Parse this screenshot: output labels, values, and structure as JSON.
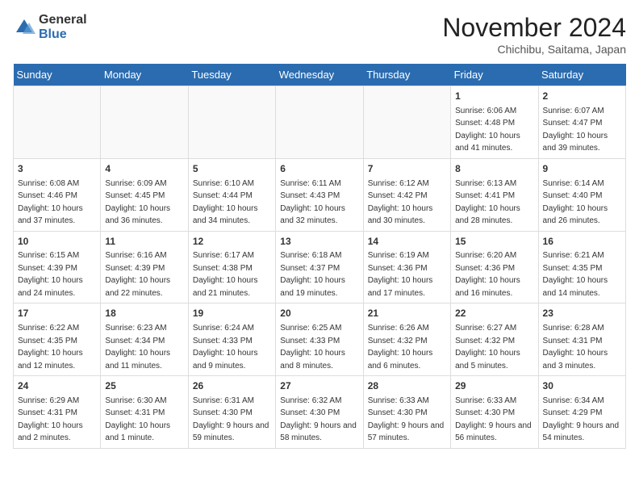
{
  "header": {
    "logo_general": "General",
    "logo_blue": "Blue",
    "month_year": "November 2024",
    "location": "Chichibu, Saitama, Japan"
  },
  "days_of_week": [
    "Sunday",
    "Monday",
    "Tuesday",
    "Wednesday",
    "Thursday",
    "Friday",
    "Saturday"
  ],
  "weeks": [
    [
      {
        "day": "",
        "info": ""
      },
      {
        "day": "",
        "info": ""
      },
      {
        "day": "",
        "info": ""
      },
      {
        "day": "",
        "info": ""
      },
      {
        "day": "",
        "info": ""
      },
      {
        "day": "1",
        "info": "Sunrise: 6:06 AM\nSunset: 4:48 PM\nDaylight: 10 hours and 41 minutes."
      },
      {
        "day": "2",
        "info": "Sunrise: 6:07 AM\nSunset: 4:47 PM\nDaylight: 10 hours and 39 minutes."
      }
    ],
    [
      {
        "day": "3",
        "info": "Sunrise: 6:08 AM\nSunset: 4:46 PM\nDaylight: 10 hours and 37 minutes."
      },
      {
        "day": "4",
        "info": "Sunrise: 6:09 AM\nSunset: 4:45 PM\nDaylight: 10 hours and 36 minutes."
      },
      {
        "day": "5",
        "info": "Sunrise: 6:10 AM\nSunset: 4:44 PM\nDaylight: 10 hours and 34 minutes."
      },
      {
        "day": "6",
        "info": "Sunrise: 6:11 AM\nSunset: 4:43 PM\nDaylight: 10 hours and 32 minutes."
      },
      {
        "day": "7",
        "info": "Sunrise: 6:12 AM\nSunset: 4:42 PM\nDaylight: 10 hours and 30 minutes."
      },
      {
        "day": "8",
        "info": "Sunrise: 6:13 AM\nSunset: 4:41 PM\nDaylight: 10 hours and 28 minutes."
      },
      {
        "day": "9",
        "info": "Sunrise: 6:14 AM\nSunset: 4:40 PM\nDaylight: 10 hours and 26 minutes."
      }
    ],
    [
      {
        "day": "10",
        "info": "Sunrise: 6:15 AM\nSunset: 4:39 PM\nDaylight: 10 hours and 24 minutes."
      },
      {
        "day": "11",
        "info": "Sunrise: 6:16 AM\nSunset: 4:39 PM\nDaylight: 10 hours and 22 minutes."
      },
      {
        "day": "12",
        "info": "Sunrise: 6:17 AM\nSunset: 4:38 PM\nDaylight: 10 hours and 21 minutes."
      },
      {
        "day": "13",
        "info": "Sunrise: 6:18 AM\nSunset: 4:37 PM\nDaylight: 10 hours and 19 minutes."
      },
      {
        "day": "14",
        "info": "Sunrise: 6:19 AM\nSunset: 4:36 PM\nDaylight: 10 hours and 17 minutes."
      },
      {
        "day": "15",
        "info": "Sunrise: 6:20 AM\nSunset: 4:36 PM\nDaylight: 10 hours and 16 minutes."
      },
      {
        "day": "16",
        "info": "Sunrise: 6:21 AM\nSunset: 4:35 PM\nDaylight: 10 hours and 14 minutes."
      }
    ],
    [
      {
        "day": "17",
        "info": "Sunrise: 6:22 AM\nSunset: 4:35 PM\nDaylight: 10 hours and 12 minutes."
      },
      {
        "day": "18",
        "info": "Sunrise: 6:23 AM\nSunset: 4:34 PM\nDaylight: 10 hours and 11 minutes."
      },
      {
        "day": "19",
        "info": "Sunrise: 6:24 AM\nSunset: 4:33 PM\nDaylight: 10 hours and 9 minutes."
      },
      {
        "day": "20",
        "info": "Sunrise: 6:25 AM\nSunset: 4:33 PM\nDaylight: 10 hours and 8 minutes."
      },
      {
        "day": "21",
        "info": "Sunrise: 6:26 AM\nSunset: 4:32 PM\nDaylight: 10 hours and 6 minutes."
      },
      {
        "day": "22",
        "info": "Sunrise: 6:27 AM\nSunset: 4:32 PM\nDaylight: 10 hours and 5 minutes."
      },
      {
        "day": "23",
        "info": "Sunrise: 6:28 AM\nSunset: 4:31 PM\nDaylight: 10 hours and 3 minutes."
      }
    ],
    [
      {
        "day": "24",
        "info": "Sunrise: 6:29 AM\nSunset: 4:31 PM\nDaylight: 10 hours and 2 minutes."
      },
      {
        "day": "25",
        "info": "Sunrise: 6:30 AM\nSunset: 4:31 PM\nDaylight: 10 hours and 1 minute."
      },
      {
        "day": "26",
        "info": "Sunrise: 6:31 AM\nSunset: 4:30 PM\nDaylight: 9 hours and 59 minutes."
      },
      {
        "day": "27",
        "info": "Sunrise: 6:32 AM\nSunset: 4:30 PM\nDaylight: 9 hours and 58 minutes."
      },
      {
        "day": "28",
        "info": "Sunrise: 6:33 AM\nSunset: 4:30 PM\nDaylight: 9 hours and 57 minutes."
      },
      {
        "day": "29",
        "info": "Sunrise: 6:33 AM\nSunset: 4:30 PM\nDaylight: 9 hours and 56 minutes."
      },
      {
        "day": "30",
        "info": "Sunrise: 6:34 AM\nSunset: 4:29 PM\nDaylight: 9 hours and 54 minutes."
      }
    ]
  ]
}
